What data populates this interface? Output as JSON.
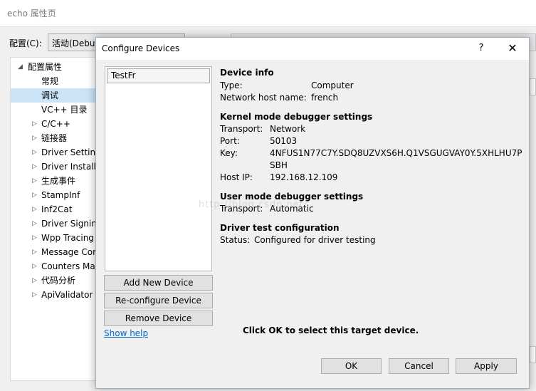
{
  "background": {
    "window_title": "echo 属性页",
    "config_label": "配置(C):",
    "config_value": "活动(Debug)",
    "tree": [
      {
        "label": "配置属性",
        "caret": "◢",
        "indent": 0,
        "selected": false
      },
      {
        "label": "常规",
        "caret": "",
        "indent": 2,
        "selected": false
      },
      {
        "label": "调试",
        "caret": "",
        "indent": 2,
        "selected": true
      },
      {
        "label": "VC++ 目录",
        "caret": "",
        "indent": 2,
        "selected": false
      },
      {
        "label": "C/C++",
        "caret": "▷",
        "indent": 1,
        "selected": false
      },
      {
        "label": "链接器",
        "caret": "▷",
        "indent": 1,
        "selected": false
      },
      {
        "label": "Driver Settings",
        "caret": "▷",
        "indent": 1,
        "selected": false
      },
      {
        "label": "Driver Install",
        "caret": "▷",
        "indent": 1,
        "selected": false
      },
      {
        "label": "生成事件",
        "caret": "▷",
        "indent": 1,
        "selected": false
      },
      {
        "label": "StampInf",
        "caret": "▷",
        "indent": 1,
        "selected": false
      },
      {
        "label": "Inf2Cat",
        "caret": "▷",
        "indent": 1,
        "selected": false
      },
      {
        "label": "Driver Signing",
        "caret": "▷",
        "indent": 1,
        "selected": false
      },
      {
        "label": "Wpp Tracing",
        "caret": "▷",
        "indent": 1,
        "selected": false
      },
      {
        "label": "Message Compiler",
        "caret": "▷",
        "indent": 1,
        "selected": false
      },
      {
        "label": "Counters Manifest",
        "caret": "▷",
        "indent": 1,
        "selected": false
      },
      {
        "label": "代码分析",
        "caret": "▷",
        "indent": 1,
        "selected": false
      },
      {
        "label": "ApiValidator",
        "caret": "▷",
        "indent": 1,
        "selected": false
      }
    ]
  },
  "dialog": {
    "title": "Configure Devices",
    "help_glyph": "?",
    "close_glyph": "✕",
    "devices": [
      "TestFr"
    ],
    "buttons": {
      "add": "Add New Device",
      "reconfigure": "Re-configure Device",
      "remove": "Remove Device",
      "show_help": "Show help",
      "ok": "OK",
      "cancel": "Cancel",
      "apply": "Apply"
    },
    "device_info": {
      "heading": "Device info",
      "type_label": "Type:",
      "type_value": "Computer",
      "host_label": "Network host name:",
      "host_value": "french"
    },
    "kernel": {
      "heading": "Kernel mode debugger settings",
      "transport_label": "Transport:",
      "transport_value": "Network",
      "port_label": "Port:",
      "port_value": "50103",
      "key_label": "Key:",
      "key_value_line1": "4NFUS1N77C7Y.SDQ8UZVXS6H.Q1VSGUGVAY0Y.5XHLHU7P",
      "key_value_line2": "SBH",
      "hostip_label": "Host IP:",
      "hostip_value": "192.168.12.109"
    },
    "user_mode": {
      "heading": "User mode debugger settings",
      "transport_label": "Transport:",
      "transport_value": "Automatic"
    },
    "driver_test": {
      "heading": "Driver test configuration",
      "status_label": "Status:",
      "status_value": "Configured for driver testing"
    },
    "ok_hint": "Click OK to select this target device.",
    "watermark": "http://blog.csdn.net/"
  }
}
